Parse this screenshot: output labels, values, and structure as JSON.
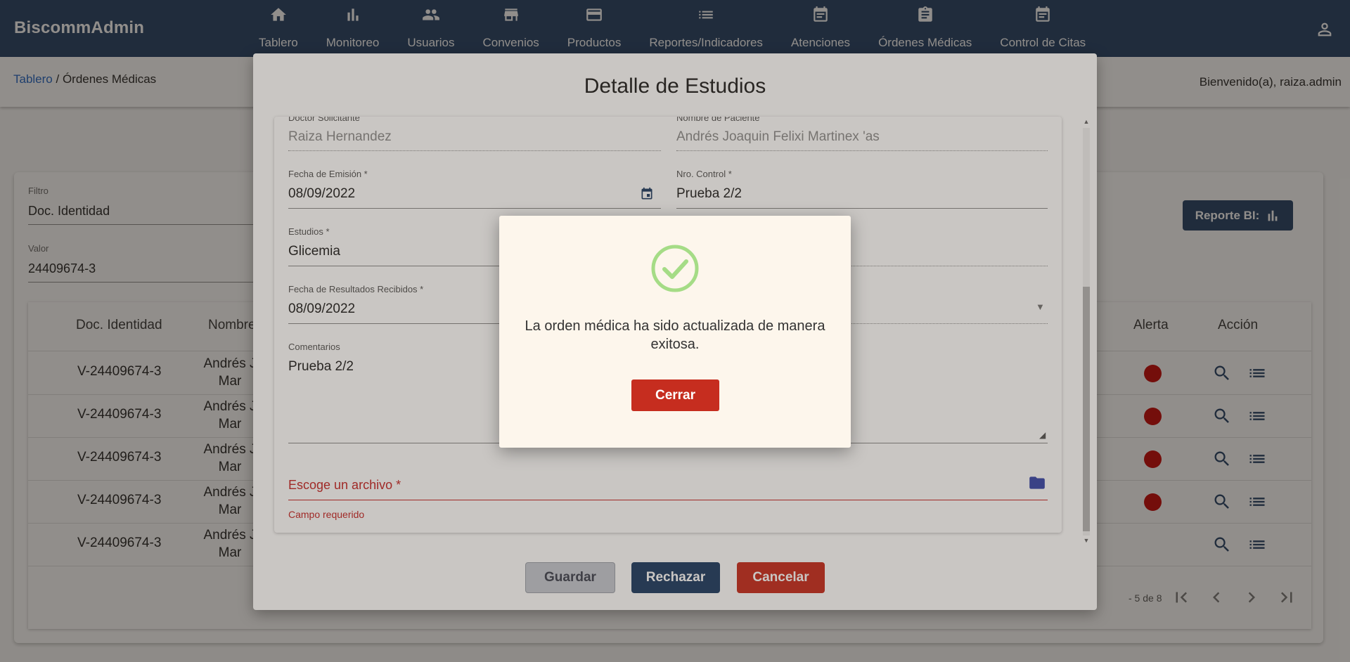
{
  "app": {
    "brand": "BiscommAdmin"
  },
  "nav": [
    {
      "label": "Tablero",
      "icon": "home-icon"
    },
    {
      "label": "Monitoreo",
      "icon": "bar-chart-icon"
    },
    {
      "label": "Usuarios",
      "icon": "people-icon"
    },
    {
      "label": "Convenios",
      "icon": "store-icon"
    },
    {
      "label": "Productos",
      "icon": "credit-card-icon"
    },
    {
      "label": "Reportes/Indicadores",
      "icon": "list-icon"
    },
    {
      "label": "Atenciones",
      "icon": "calendar-icon"
    },
    {
      "label": "Órdenes Médicas",
      "icon": "clipboard-icon"
    },
    {
      "label": "Control de Citas",
      "icon": "calendar-icon"
    }
  ],
  "breadcrumb": {
    "root": "Tablero",
    "separator": " / ",
    "current": "Órdenes Médicas"
  },
  "welcome": "Bienvenido(a), raiza.admin",
  "filters": {
    "filter_label": "Filtro",
    "filter_value": "Doc. Identidad",
    "value_label": "Valor",
    "value_value": "24409674-3",
    "report_button": "Reporte BI:"
  },
  "table": {
    "headers": {
      "doc": "Doc. Identidad",
      "name": "Nombre",
      "alert": "Alerta",
      "action": "Acción"
    },
    "rows": [
      {
        "doc": "V-24409674-3",
        "name": "Andrés J Mar",
        "alert": true
      },
      {
        "doc": "V-24409674-3",
        "name": "Andrés J Mar",
        "alert": true
      },
      {
        "doc": "V-24409674-3",
        "name": "Andrés J Mar",
        "alert": true
      },
      {
        "doc": "V-24409674-3",
        "name": "Andrés J Mar",
        "alert": true
      },
      {
        "doc": "V-24409674-3",
        "name": "Andrés J Mar",
        "alert": false
      }
    ],
    "pager_text": "- 5 de 8"
  },
  "dialog": {
    "title": "Detalle de Estudios",
    "doctor_label": "Doctor Solicitante",
    "doctor_value": "Raiza Hernandez",
    "patient_label": "Nombre de Paciente",
    "patient_value": "Andrés Joaquin Felixi Martinex 'as",
    "emission_label": "Fecha de Emisión *",
    "emission_value": "08/09/2022",
    "control_label": "Nro. Control *",
    "control_value": "Prueba 2/2",
    "studies_label": "Estudios *",
    "studies_value": "Glicemia",
    "results_label": "Fecha de Resultados Recibidos *",
    "results_value": "08/09/2022",
    "comments_label": "Comentarios",
    "comments_value": "Prueba 2/2",
    "file_label": "Escoge un archivo *",
    "file_error": "Campo requerido",
    "save_button": "Guardar",
    "reject_button": "Rechazar",
    "cancel_button": "Cancelar"
  },
  "success_modal": {
    "message": "La orden médica ha sido actualizada de manera exitosa.",
    "close_button": "Cerrar",
    "check_color": "#a5dc86"
  },
  "colors": {
    "primary": "#1f3d64",
    "danger": "#c62d1f",
    "link": "#1e63c4",
    "alert_dot": "#c40000"
  }
}
